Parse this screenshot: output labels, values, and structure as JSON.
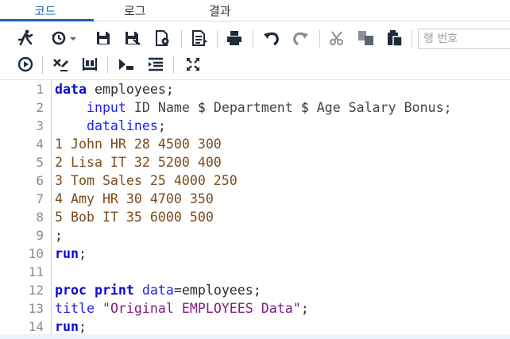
{
  "tabs": [
    {
      "label": "코드",
      "active": true
    },
    {
      "label": "로그",
      "active": false
    },
    {
      "label": "결과",
      "active": false
    }
  ],
  "toolbar": {
    "line_number_placeholder": "행 번호",
    "icons": [
      "run-icon",
      "history-icon",
      "save-icon",
      "save-as-icon",
      "save-program-icon",
      "export-icon",
      "print-icon",
      "undo-icon",
      "redo-icon",
      "cut-icon",
      "copy-icon",
      "paste-icon"
    ],
    "icons_row2": [
      "submit-icon",
      "clear-icon",
      "format-icon",
      "next-icon",
      "indent-icon",
      "maximize-icon"
    ]
  },
  "editor": {
    "line_numbers": [
      "1",
      "2",
      "3",
      "4",
      "5",
      "6",
      "7",
      "8",
      "9",
      "10",
      "11",
      "12",
      "13",
      "14"
    ],
    "lines": [
      [
        {
          "t": "data",
          "c": "kw"
        },
        {
          "t": " employees;",
          "c": "plain"
        }
      ],
      [
        {
          "t": "    input",
          "c": "kw2"
        },
        {
          "t": " ID Name ",
          "c": "gray"
        },
        {
          "t": "$",
          "c": "plain"
        },
        {
          "t": " Department ",
          "c": "gray"
        },
        {
          "t": "$",
          "c": "plain"
        },
        {
          "t": " Age Salary Bonus;",
          "c": "gray"
        }
      ],
      [
        {
          "t": "    datalines",
          "c": "kw2"
        },
        {
          "t": ";",
          "c": "plain"
        }
      ],
      [
        {
          "t": "1 John HR 28 4500 300",
          "c": "dt"
        }
      ],
      [
        {
          "t": "2 Lisa IT 32 5200 400",
          "c": "dt"
        }
      ],
      [
        {
          "t": "3 Tom Sales 25 4000 250",
          "c": "dt"
        }
      ],
      [
        {
          "t": "4 Amy HR 30 4700 350",
          "c": "dt"
        }
      ],
      [
        {
          "t": "5 Bob IT 35 6000 500",
          "c": "dt"
        }
      ],
      [
        {
          "t": ";",
          "c": "plain"
        }
      ],
      [
        {
          "t": "run",
          "c": "kw"
        },
        {
          "t": ";",
          "c": "plain"
        }
      ],
      [],
      [
        {
          "t": "proc print",
          "c": "kw"
        },
        {
          "t": " ",
          "c": "plain"
        },
        {
          "t": "data",
          "c": "kw2"
        },
        {
          "t": "=employees;",
          "c": "plain"
        }
      ],
      [
        {
          "t": "title",
          "c": "kw2"
        },
        {
          "t": " ",
          "c": "plain"
        },
        {
          "t": "\"Original EMPLOYEES Data\"",
          "c": "str"
        },
        {
          "t": ";",
          "c": "plain"
        }
      ],
      [
        {
          "t": "run",
          "c": "kw"
        },
        {
          "t": ";",
          "c": "plain"
        }
      ]
    ]
  }
}
